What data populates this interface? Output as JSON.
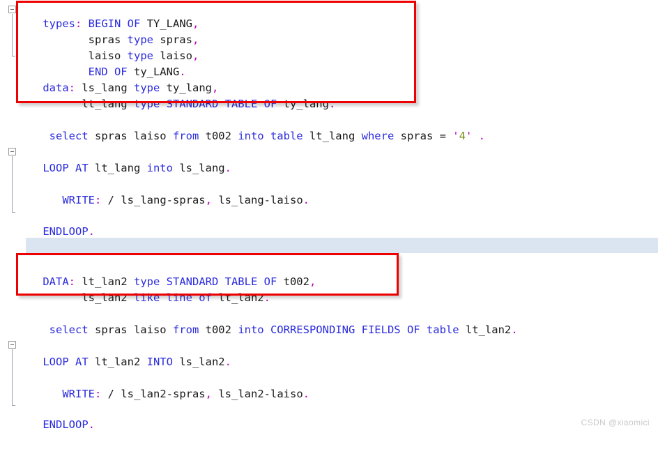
{
  "editor": {
    "language": "ABAP",
    "background_color": "#ffffff",
    "keyword_color": "#2b2bdd",
    "identifier_color": "#1a1a1a",
    "punctuation_color": "#b500b5",
    "string_color": "#7a8c18",
    "highlight_row_color": "#dbe4f1",
    "annotation_color": "#ee0000"
  },
  "lines": [
    {
      "n": 1,
      "text": "types: BEGIN OF TY_LANG,"
    },
    {
      "n": 2,
      "text": "       spras type spras,"
    },
    {
      "n": 3,
      "text": "       laiso type laiso,"
    },
    {
      "n": 4,
      "text": "       END OF ty_LANG."
    },
    {
      "n": 5,
      "text": "data: ls_lang type ty_lang,"
    },
    {
      "n": 6,
      "text": "      lt_lang type STANDARD TABLE OF ty_lang."
    },
    {
      "n": 7,
      "text": " select spras laiso from t002 into table lt_lang where spras = '4' ."
    },
    {
      "n": 8,
      "text": "LOOP AT lt_lang into ls_lang."
    },
    {
      "n": 9,
      "text": ""
    },
    {
      "n": 10,
      "text": "   WRITE: / ls_lang-spras, ls_lang-laiso."
    },
    {
      "n": 11,
      "text": ""
    },
    {
      "n": 12,
      "text": "ENDLOOP."
    },
    {
      "n": 13,
      "text": ""
    },
    {
      "n": 14,
      "text": ""
    },
    {
      "n": 15,
      "text": "DATA: lt_lan2 type STANDARD TABLE OF t002,"
    },
    {
      "n": 16,
      "text": "      ls_lan2 like line of lt_lan2."
    },
    {
      "n": 17,
      "text": " select spras laiso from t002 into CORRESPONDING FIELDS OF table lt_lan2."
    },
    {
      "n": 18,
      "text": "LOOP AT lt_lan2 INTO ls_lan2."
    },
    {
      "n": 19,
      "text": ""
    },
    {
      "n": 20,
      "text": "   WRITE: / ls_lan2-spras, ls_lan2-laiso."
    },
    {
      "n": 21,
      "text": ""
    },
    {
      "n": 22,
      "text": "ENDLOOP."
    }
  ],
  "tokens": {
    "l1": {
      "kw1": "types",
      "p1": ":",
      "kw2": " BEGIN OF ",
      "id1": "TY_LANG",
      "p2": ","
    },
    "l2": {
      "id1": "       spras ",
      "kw1": "type",
      "id2": " spras",
      "p1": ","
    },
    "l3": {
      "id1": "       laiso ",
      "kw1": "type",
      "id2": " laiso",
      "p1": ","
    },
    "l4": {
      "kw1": "       END OF ",
      "id1": "ty_LANG",
      "p1": "."
    },
    "l5": {
      "kw1": "data",
      "p1": ":",
      "id1": " ls_lang ",
      "kw2": "type",
      "id2": " ty_lang",
      "p2": ","
    },
    "l6": {
      "id1": "      lt_lang ",
      "kw1": "type STANDARD TABLE OF ",
      "id2": "ty_lang",
      "p1": "."
    },
    "l7": {
      "kw1": " select ",
      "id1": "spras laiso ",
      "kw2": "from ",
      "id2": "t002 ",
      "kw3": "into table ",
      "id3": "lt_lang ",
      "kw4": "where ",
      "id4": "spras ",
      "op1": "= ",
      "q1": "'",
      "s1": "4",
      "q2": "'",
      "p1": " ."
    },
    "l8": {
      "kw1": "LOOP AT ",
      "id1": "lt_lang ",
      "kw2": "into ",
      "id2": "ls_lang",
      "p1": "."
    },
    "l10": {
      "kw1": "   WRITE",
      "p1": ":",
      "op1": " / ",
      "id1": "ls_lang-spras",
      "p2": ",",
      "id2": " ls_lang-laiso",
      "p3": "."
    },
    "l12": {
      "kw1": "ENDLOOP",
      "p1": "."
    },
    "l15": {
      "kw1": "DATA",
      "p1": ":",
      "id1": " lt_lan2 ",
      "kw2": "type STANDARD TABLE OF ",
      "id2": "t002",
      "p2": ","
    },
    "l16": {
      "id1": "      ls_lan2 ",
      "kw1": "like line of ",
      "id2": "lt_lan2",
      "p1": "."
    },
    "l17": {
      "kw1": " select ",
      "id1": "spras laiso ",
      "kw2": "from ",
      "id2": "t002 ",
      "kw3": "into CORRESPONDING FIELDS OF table ",
      "id3": "lt_lan2",
      "p1": "."
    },
    "l18": {
      "kw1": "LOOP AT ",
      "id1": "lt_lan2 ",
      "kw2": "INTO ",
      "id2": "ls_lan2",
      "p1": "."
    },
    "l20": {
      "kw1": "   WRITE",
      "p1": ":",
      "op1": " / ",
      "id1": "ls_lan2-spras",
      "p2": ",",
      "id2": " ls_lan2-laiso",
      "p3": "."
    },
    "l22": {
      "kw1": "ENDLOOP",
      "p1": "."
    }
  },
  "annotations": [
    {
      "id": "redbox-declaration-types",
      "note": "highlights the TYPES/DATA declaration block"
    },
    {
      "id": "redbox-declaration-data",
      "note": "highlights the DATA lt_lan2 declaration block"
    }
  ],
  "watermark": {
    "text": "CSDN @xiaomici"
  }
}
